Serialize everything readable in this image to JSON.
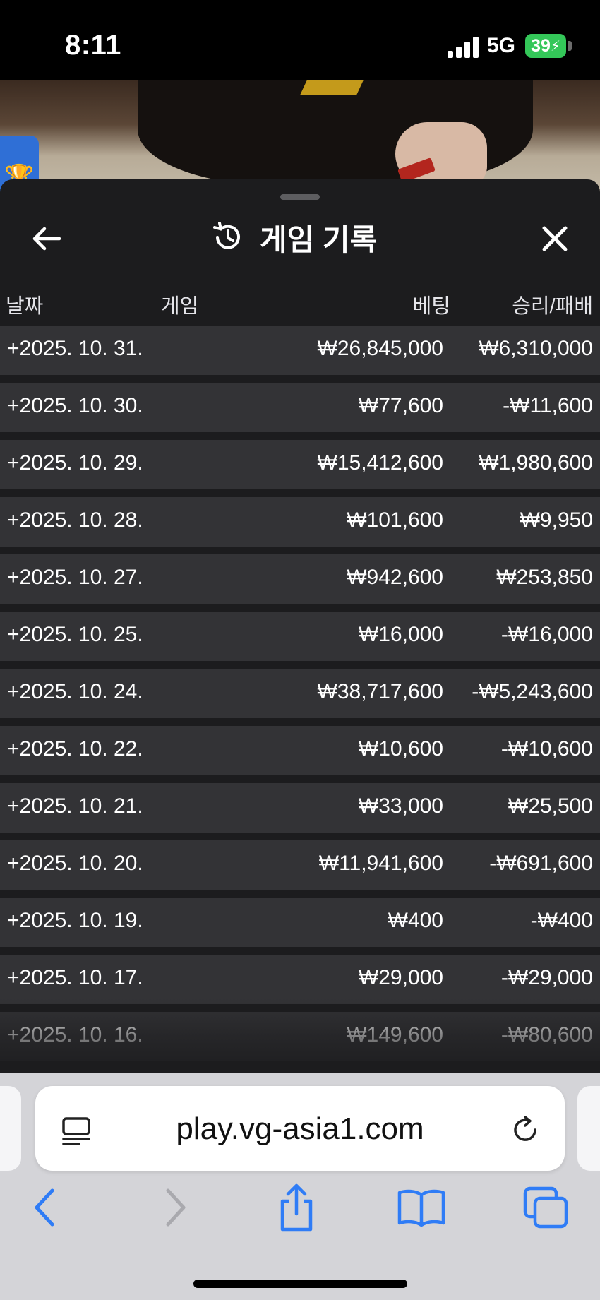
{
  "status_bar": {
    "time": "8:11",
    "network": "5G",
    "battery": "39"
  },
  "panel": {
    "title": "게임 기록",
    "icons": {
      "back": "arrow-left-icon",
      "history": "history-icon",
      "close": "close-icon"
    }
  },
  "table": {
    "headers": {
      "date": "날짜",
      "game": "게임",
      "bet": "베팅",
      "result": "승리/패배"
    },
    "rows": [
      {
        "date": "+2025. 10. 31.",
        "bet": "₩26,845,000",
        "result": "₩6,310,000"
      },
      {
        "date": "+2025. 10. 30.",
        "bet": "₩77,600",
        "result": "-₩11,600"
      },
      {
        "date": "+2025. 10. 29.",
        "bet": "₩15,412,600",
        "result": "₩1,980,600"
      },
      {
        "date": "+2025. 10. 28.",
        "bet": "₩101,600",
        "result": "₩9,950"
      },
      {
        "date": "+2025. 10. 27.",
        "bet": "₩942,600",
        "result": "₩253,850"
      },
      {
        "date": "+2025. 10. 25.",
        "bet": "₩16,000",
        "result": "-₩16,000"
      },
      {
        "date": "+2025. 10. 24.",
        "bet": "₩38,717,600",
        "result": "-₩5,243,600"
      },
      {
        "date": "+2025. 10. 22.",
        "bet": "₩10,600",
        "result": "-₩10,600"
      },
      {
        "date": "+2025. 10. 21.",
        "bet": "₩33,000",
        "result": "₩25,500"
      },
      {
        "date": "+2025. 10. 20.",
        "bet": "₩11,941,600",
        "result": "-₩691,600"
      },
      {
        "date": "+2025. 10. 19.",
        "bet": "₩400",
        "result": "-₩400"
      },
      {
        "date": "+2025. 10. 17.",
        "bet": "₩29,000",
        "result": "-₩29,000"
      },
      {
        "date": "+2025. 10. 16.",
        "bet": "₩149,600",
        "result": "-₩80,600"
      }
    ]
  },
  "browser": {
    "url": "play.vg-asia1.com",
    "accent_color": "#2f7cf6",
    "disabled_color": "#a9a9ae",
    "icons": {
      "reader": "reader-mode-icon",
      "reload": "reload-icon",
      "back": "chevron-left-icon",
      "forward": "chevron-right-icon",
      "share": "share-icon",
      "bookmarks": "book-icon",
      "tabs": "tabs-icon"
    }
  }
}
